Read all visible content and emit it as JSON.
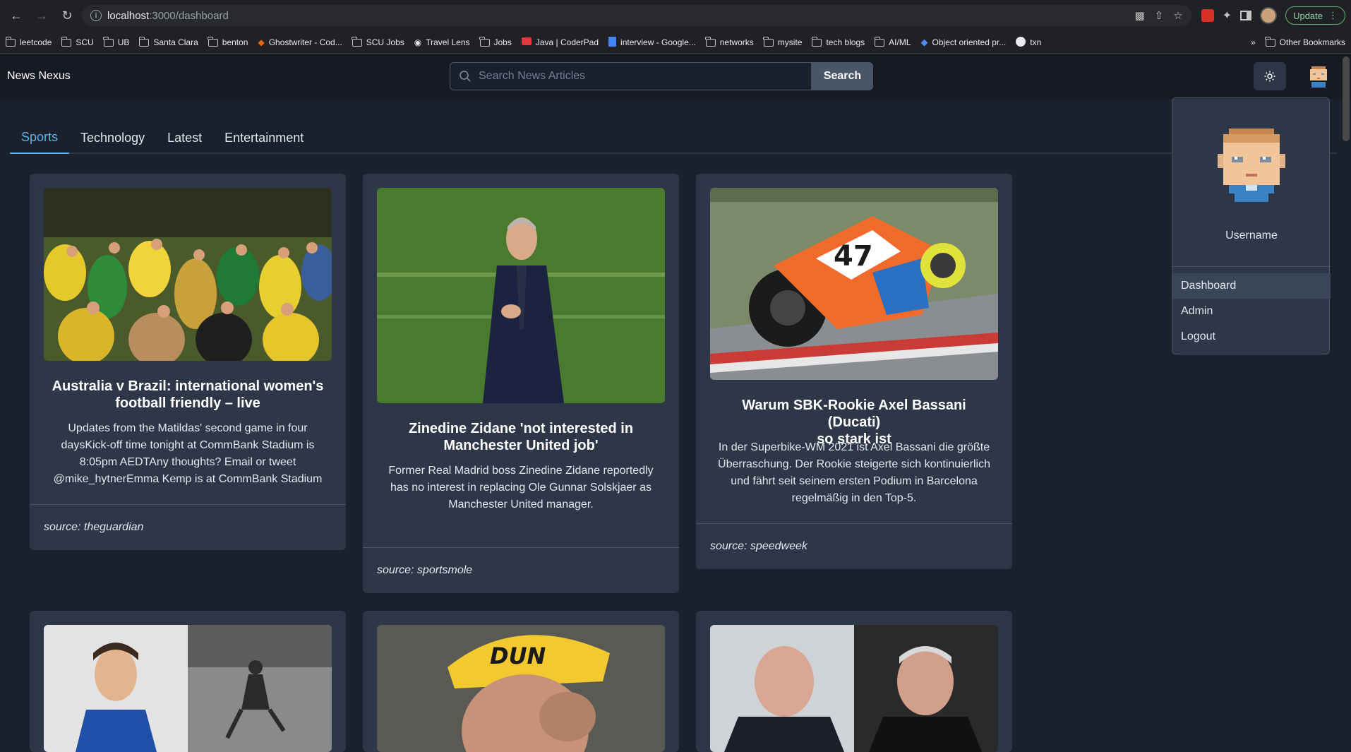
{
  "browser": {
    "url_host": "localhost",
    "url_path": ":3000/dashboard",
    "update_label": "Update",
    "bookmarks": [
      {
        "label": "leetcode",
        "icon": "folder-icon"
      },
      {
        "label": "SCU",
        "icon": "folder-icon"
      },
      {
        "label": "UB",
        "icon": "folder-icon"
      },
      {
        "label": "Santa Clara",
        "icon": "folder-icon"
      },
      {
        "label": "benton",
        "icon": "folder-icon"
      },
      {
        "label": "Ghostwriter - Cod...",
        "icon": "ghostwriter-icon"
      },
      {
        "label": "SCU Jobs",
        "icon": "folder-icon"
      },
      {
        "label": "Travel Lens",
        "icon": "pin-icon"
      },
      {
        "label": "Jobs",
        "icon": "folder-icon"
      },
      {
        "label": "Java | CoderPad",
        "icon": "coderpad-icon"
      },
      {
        "label": "interview - Google...",
        "icon": "docs-icon"
      },
      {
        "label": "networks",
        "icon": "folder-icon"
      },
      {
        "label": "mysite",
        "icon": "folder-icon"
      },
      {
        "label": "tech blogs",
        "icon": "folder-icon"
      },
      {
        "label": "AI/ML",
        "icon": "folder-icon"
      },
      {
        "label": "Object oriented pr...",
        "icon": "diamond-icon"
      },
      {
        "label": "txn",
        "icon": "github-icon"
      }
    ],
    "more_label": "»",
    "other_bookmarks": "Other Bookmarks"
  },
  "app": {
    "brand": "News Nexus",
    "search_placeholder": "Search News Articles",
    "search_button": "Search"
  },
  "tabs": [
    {
      "label": "Sports",
      "active": true
    },
    {
      "label": "Technology",
      "active": false
    },
    {
      "label": "Latest",
      "active": false
    },
    {
      "label": "Entertainment",
      "active": false
    }
  ],
  "cards": [
    {
      "title_lines": [
        "Australia v Brazil: international women's",
        "football friendly – live"
      ],
      "desc_lines": [
        "Updates from the Matildas' second game in four",
        "daysKick-off time tonight at CommBank Stadium is",
        "8:05pm AEDTAny thoughts? Email or tweet",
        "@mike_hytnerEmma Kemp is at CommBank Stadium"
      ],
      "source": "source: theguardian"
    },
    {
      "title_lines": [
        "Zinedine Zidane 'not interested in",
        "Manchester United job'"
      ],
      "desc_lines": [
        "Former Real Madrid boss Zinedine Zidane reportedly",
        "has no interest in replacing Ole Gunnar Solskjaer as",
        "Manchester United manager."
      ],
      "source": "source: sportsmole"
    },
    {
      "title_lines": [
        "Warum SBK-Rookie Axel Bassani (Ducati)",
        "so stark ist"
      ],
      "desc_lines": [
        "In der Superbike-WM 2021 ist Axel Bassani die größte",
        "Überraschung. Der Rookie steigerte sich kontinuierlich",
        "und fährt seit seinem ersten Podium in Barcelona",
        "regelmäßig in den Top-5."
      ],
      "source": "source: speedweek"
    }
  ],
  "dropdown": {
    "username": "Username",
    "items": [
      "Dashboard",
      "Admin",
      "Logout"
    ]
  },
  "colors": {
    "accent": "#63b3ed",
    "card": "#2d3748",
    "background": "#1a202c"
  }
}
